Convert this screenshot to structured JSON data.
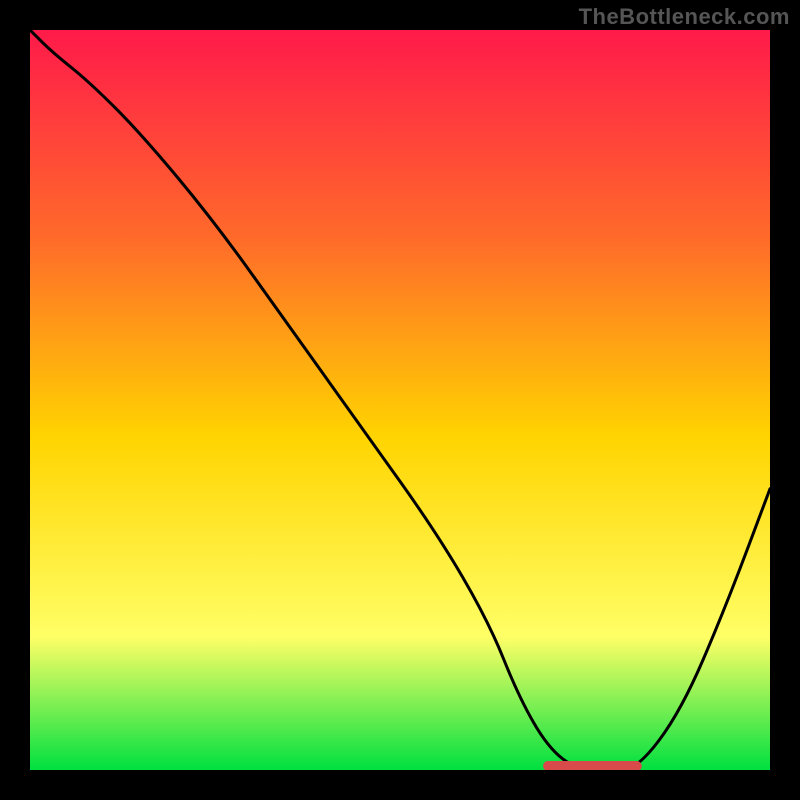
{
  "watermark": "TheBottleneck.com",
  "colors": {
    "bg": "#000000",
    "gradient_top": "#ff1a4a",
    "gradient_mid1": "#ff6a2a",
    "gradient_mid2": "#ffd400",
    "gradient_mid3": "#ffff66",
    "gradient_bottom": "#00e040",
    "curve": "#000000",
    "marker": "#d94a4a"
  },
  "chart_data": {
    "type": "line",
    "title": "",
    "xlabel": "",
    "ylabel": "",
    "xlim": [
      0,
      100
    ],
    "ylim": [
      0,
      100
    ],
    "series": [
      {
        "name": "bottleneck-curve",
        "x": [
          0,
          3,
          8,
          15,
          25,
          35,
          45,
          55,
          62,
          66,
          70,
          74,
          78,
          82,
          88,
          94,
          100
        ],
        "y": [
          100,
          97,
          93,
          86,
          74,
          60,
          46,
          32,
          20,
          10,
          3,
          0,
          0,
          0,
          8,
          22,
          38
        ]
      }
    ],
    "annotations": [
      {
        "name": "min-marker",
        "x_range": [
          70,
          82
        ],
        "y": 0
      }
    ]
  }
}
